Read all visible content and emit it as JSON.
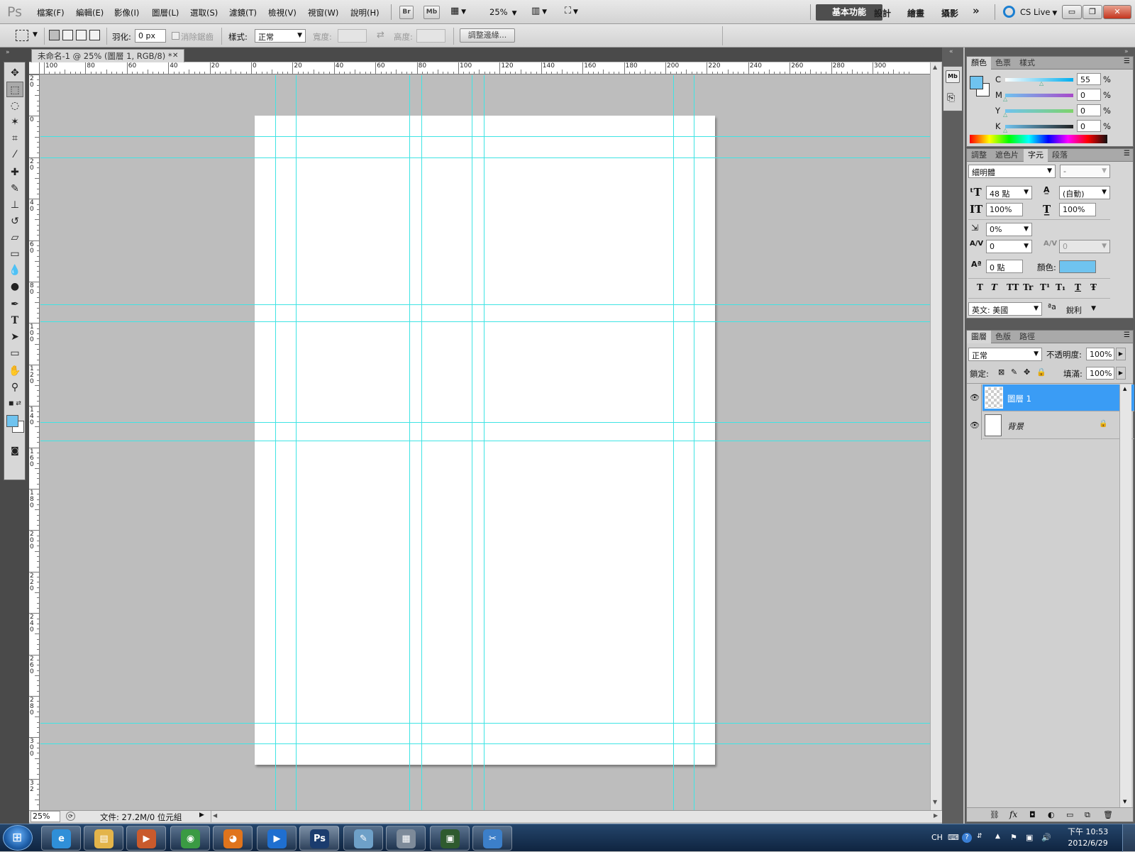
{
  "app": {
    "logo": "Ps"
  },
  "menu": [
    "檔案(F)",
    "編輯(E)",
    "影像(I)",
    "圖層(L)",
    "選取(S)",
    "濾鏡(T)",
    "檢視(V)",
    "視窗(W)",
    "說明(H)"
  ],
  "appbar": {
    "bridge": "Br",
    "minibridge": "Mb",
    "zoom": "25%"
  },
  "workspaces": {
    "active": "基本功能",
    "items": [
      "設計",
      "繪畫",
      "攝影"
    ],
    "more": "»",
    "cs_live": "CS Live"
  },
  "window_controls": {
    "minimize": "▭",
    "restore": "❐",
    "close": "✕"
  },
  "options": {
    "feather_label": "羽化:",
    "feather_value": "0 px",
    "antialias_label": "消除鋸齒",
    "style_label": "樣式:",
    "style_value": "正常",
    "width_label": "寬度:",
    "height_label": "高度:",
    "swap_icon": "⇄",
    "refine_edge": "調整邊緣..."
  },
  "document": {
    "tab_title": "未命名-1 @ 25% (圖層 1, RGB/8) *",
    "close": "✕",
    "ruler_top_labels": [
      "100",
      "80",
      "60",
      "40",
      "20",
      "0",
      "20",
      "40",
      "60",
      "80",
      "100",
      "120",
      "140",
      "160",
      "180",
      "200",
      "220",
      "240",
      "260",
      "280",
      "300"
    ],
    "ruler_left_labels": [
      "2\n0",
      "0",
      "2\n0",
      "4\n0",
      "6\n0",
      "8\n0",
      "1\n0\n0",
      "1\n2\n0",
      "1\n4\n0",
      "1\n6\n0",
      "1\n8\n0",
      "2\n0\n0",
      "2\n2\n0",
      "2\n4\n0",
      "2\n6\n0",
      "2\n8\n0",
      "3\n0\n0",
      "3\n2"
    ]
  },
  "status": {
    "zoom": "25%",
    "doc_info": "文件: 27.2M/0 位元組"
  },
  "color_panel": {
    "tabs": [
      "顏色",
      "色票",
      "樣式"
    ],
    "channels": [
      {
        "label": "C",
        "value": "55",
        "unit": "%"
      },
      {
        "label": "M",
        "value": "0",
        "unit": "%"
      },
      {
        "label": "Y",
        "value": "0",
        "unit": "%"
      },
      {
        "label": "K",
        "value": "0",
        "unit": "%"
      }
    ],
    "foreground": "#6fc3ef",
    "background": "#ffffff"
  },
  "character_panel": {
    "tabs": [
      "調整",
      "遮色片",
      "字元",
      "段落"
    ],
    "font_family": "細明體",
    "font_style": "-",
    "size": "48 點",
    "leading": "(自動)",
    "vscale": "100%",
    "hscale": "100%",
    "tsume": "0%",
    "kerning": "0",
    "tracking": "0",
    "baseline": "0 點",
    "color_label": "顏色:",
    "color": "#6fc3ef",
    "styles": [
      "T",
      "T",
      "TT",
      "Tr",
      "T¹",
      "T₁",
      "T",
      "Ŧ"
    ],
    "language": "英文: 美國",
    "aa_icon": "ªa",
    "antialias": "銳利"
  },
  "layers_panel": {
    "tabs": [
      "圖層",
      "色版",
      "路徑"
    ],
    "blend_mode": "正常",
    "opacity_label": "不透明度:",
    "opacity": "100%",
    "lock_label": "鎖定:",
    "fill_label": "填滿:",
    "fill": "100%",
    "layers": [
      {
        "name": "圖層 1",
        "selected": true
      },
      {
        "name": "背景",
        "selected": false
      }
    ]
  },
  "taskbar": {
    "apps": [
      {
        "name": "Internet Explorer",
        "glyph": "e",
        "color": "#2f8fd8"
      },
      {
        "name": "Explorer",
        "glyph": "▤",
        "color": "#e3b44a"
      },
      {
        "name": "Media Center",
        "glyph": "▶",
        "color": "#c95a2c"
      },
      {
        "name": "Chrome",
        "glyph": "◉",
        "color": "#3a9a43"
      },
      {
        "name": "Firefox",
        "glyph": "◕",
        "color": "#e0741c"
      },
      {
        "name": "Media Player",
        "glyph": "▶",
        "color": "#1f6fd0"
      },
      {
        "name": "Photoshop",
        "glyph": "Ps",
        "color": "#1b3c6e"
      },
      {
        "name": "Paint",
        "glyph": "✎",
        "color": "#6ea0c8"
      },
      {
        "name": "Calculator",
        "glyph": "▦",
        "color": "#7d8a99"
      },
      {
        "name": "Terminal",
        "glyph": "▣",
        "color": "#2e5a2e"
      },
      {
        "name": "Snipping",
        "glyph": "✂",
        "color": "#3c7fc9"
      }
    ],
    "lang": "CH",
    "time": "下午 10:53",
    "date": "2012/6/29"
  }
}
